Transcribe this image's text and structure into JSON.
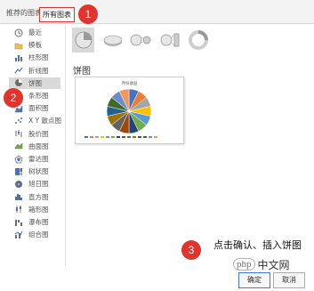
{
  "tabs": {
    "recommended": "推荐的图表",
    "all_charts": "所有图表"
  },
  "sidebar": {
    "items": [
      {
        "label": "最近",
        "icon": "recent-icon"
      },
      {
        "label": "模板",
        "icon": "template-folder-icon"
      },
      {
        "label": "柱形图",
        "icon": "column-chart-icon"
      },
      {
        "label": "折线图",
        "icon": "line-chart-icon"
      },
      {
        "label": "饼图",
        "icon": "pie-chart-icon",
        "selected": true
      },
      {
        "label": "条形图",
        "icon": "bar-chart-icon"
      },
      {
        "label": "面积图",
        "icon": "area-chart-icon"
      },
      {
        "label": "X Y 散点图",
        "icon": "scatter-chart-icon"
      },
      {
        "label": "股价图",
        "icon": "stock-chart-icon"
      },
      {
        "label": "曲面图",
        "icon": "surface-chart-icon"
      },
      {
        "label": "雷达图",
        "icon": "radar-chart-icon"
      },
      {
        "label": "树状图",
        "icon": "treemap-chart-icon"
      },
      {
        "label": "旭日图",
        "icon": "sunburst-chart-icon"
      },
      {
        "label": "直方图",
        "icon": "histogram-chart-icon"
      },
      {
        "label": "箱形图",
        "icon": "box-whisker-chart-icon"
      },
      {
        "label": "瀑布图",
        "icon": "waterfall-chart-icon"
      },
      {
        "label": "组合图",
        "icon": "combo-chart-icon"
      }
    ]
  },
  "subtypes": [
    {
      "icon": "pie-icon",
      "selected": true
    },
    {
      "icon": "pie-3d-icon"
    },
    {
      "icon": "pie-of-pie-icon"
    },
    {
      "icon": "bar-of-pie-icon"
    },
    {
      "icon": "doughnut-icon"
    }
  ],
  "section_title": "饼图",
  "preview": {
    "title": "月份收益",
    "slice_colors": [
      "#4472c4",
      "#ed7d31",
      "#a5a5a5",
      "#ffc000",
      "#5b9bd5",
      "#70ad47",
      "#264478",
      "#9e480e",
      "#636363",
      "#997300",
      "#255e91",
      "#43682b",
      "#698ed0",
      "#f1975a"
    ]
  },
  "annotations": {
    "badge1": "1",
    "badge2": "2",
    "badge3": "3",
    "step3_text": "点击确认、插入饼图"
  },
  "watermark": {
    "logo": "php",
    "text": "中文网"
  },
  "buttons": {
    "ok": "确定",
    "cancel": "取消"
  },
  "colors": {
    "accent_red": "#e0342d",
    "selection_gray": "#d9d9d9",
    "primary_border": "#3d7bd3"
  }
}
